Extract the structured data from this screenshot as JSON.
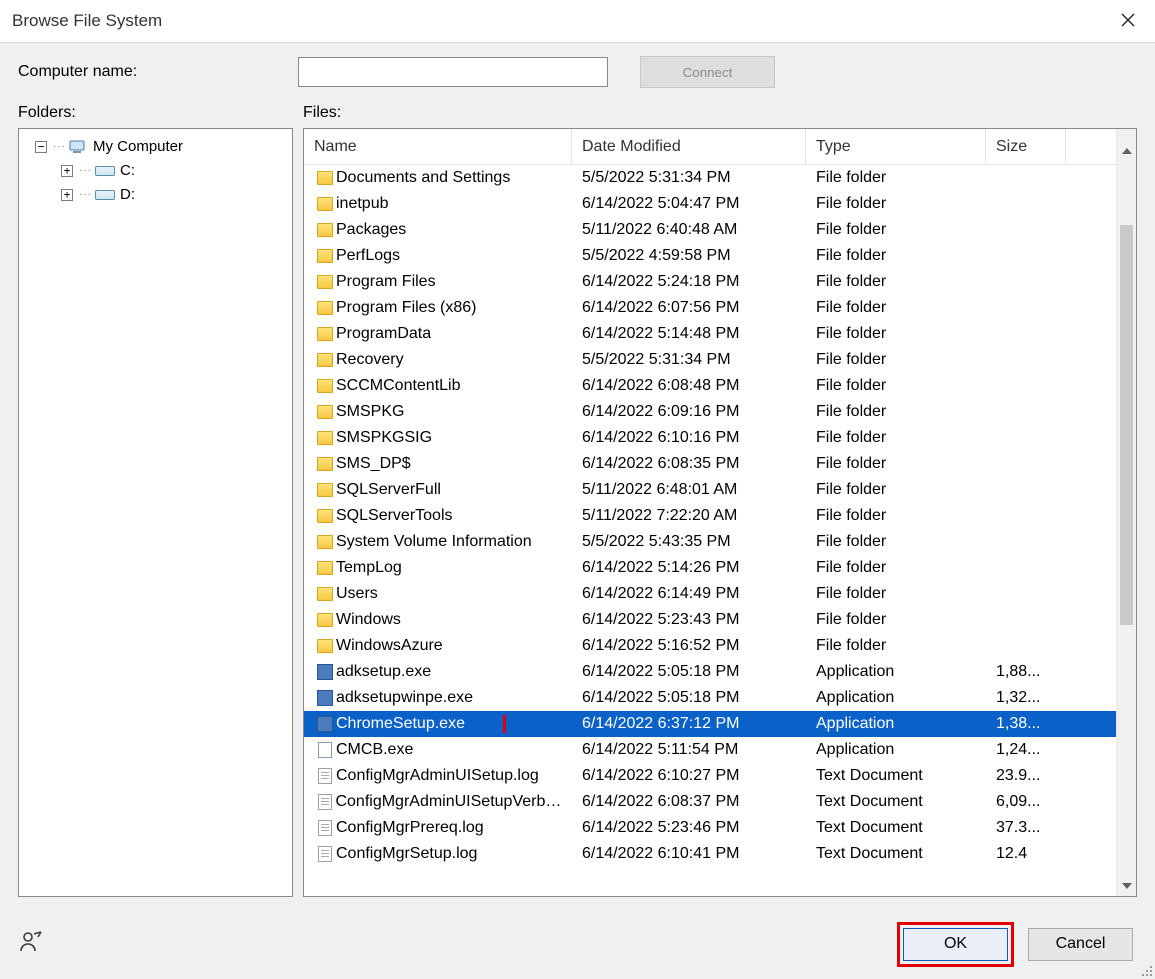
{
  "title": "Browse File System",
  "labels": {
    "computer_name": "Computer name:",
    "connect": "Connect",
    "folders": "Folders:",
    "files": "Files:"
  },
  "tree": {
    "root": "My Computer",
    "drives": [
      "C:",
      "D:"
    ]
  },
  "columns": {
    "name": "Name",
    "date": "Date Modified",
    "type": "Type",
    "size": "Size"
  },
  "files": [
    {
      "icon": "folder",
      "name": "Documents and Settings",
      "date": "5/5/2022 5:31:34 PM",
      "type": "File folder",
      "size": ""
    },
    {
      "icon": "folder",
      "name": "inetpub",
      "date": "6/14/2022 5:04:47 PM",
      "type": "File folder",
      "size": ""
    },
    {
      "icon": "folder",
      "name": "Packages",
      "date": "5/11/2022 6:40:48 AM",
      "type": "File folder",
      "size": ""
    },
    {
      "icon": "folder",
      "name": "PerfLogs",
      "date": "5/5/2022 4:59:58 PM",
      "type": "File folder",
      "size": ""
    },
    {
      "icon": "folder",
      "name": "Program Files",
      "date": "6/14/2022 5:24:18 PM",
      "type": "File folder",
      "size": ""
    },
    {
      "icon": "folder",
      "name": "Program Files (x86)",
      "date": "6/14/2022 6:07:56 PM",
      "type": "File folder",
      "size": ""
    },
    {
      "icon": "folder",
      "name": "ProgramData",
      "date": "6/14/2022 5:14:48 PM",
      "type": "File folder",
      "size": ""
    },
    {
      "icon": "folder",
      "name": "Recovery",
      "date": "5/5/2022 5:31:34 PM",
      "type": "File folder",
      "size": ""
    },
    {
      "icon": "folder",
      "name": "SCCMContentLib",
      "date": "6/14/2022 6:08:48 PM",
      "type": "File folder",
      "size": ""
    },
    {
      "icon": "folder",
      "name": "SMSPKG",
      "date": "6/14/2022 6:09:16 PM",
      "type": "File folder",
      "size": ""
    },
    {
      "icon": "folder",
      "name": "SMSPKGSIG",
      "date": "6/14/2022 6:10:16 PM",
      "type": "File folder",
      "size": ""
    },
    {
      "icon": "folder",
      "name": "SMS_DP$",
      "date": "6/14/2022 6:08:35 PM",
      "type": "File folder",
      "size": ""
    },
    {
      "icon": "folder",
      "name": "SQLServerFull",
      "date": "5/11/2022 6:48:01 AM",
      "type": "File folder",
      "size": ""
    },
    {
      "icon": "folder",
      "name": "SQLServerTools",
      "date": "5/11/2022 7:22:20 AM",
      "type": "File folder",
      "size": ""
    },
    {
      "icon": "folder",
      "name": "System Volume Information",
      "date": "5/5/2022 5:43:35 PM",
      "type": "File folder",
      "size": ""
    },
    {
      "icon": "folder",
      "name": "TempLog",
      "date": "6/14/2022 5:14:26 PM",
      "type": "File folder",
      "size": ""
    },
    {
      "icon": "folder",
      "name": "Users",
      "date": "6/14/2022 6:14:49 PM",
      "type": "File folder",
      "size": ""
    },
    {
      "icon": "folder",
      "name": "Windows",
      "date": "6/14/2022 5:23:43 PM",
      "type": "File folder",
      "size": ""
    },
    {
      "icon": "folder",
      "name": "WindowsAzure",
      "date": "6/14/2022 5:16:52 PM",
      "type": "File folder",
      "size": ""
    },
    {
      "icon": "exe",
      "name": "adksetup.exe",
      "date": "6/14/2022 5:05:18 PM",
      "type": "Application",
      "size": "1,88..."
    },
    {
      "icon": "exe",
      "name": "adksetupwinpe.exe",
      "date": "6/14/2022 5:05:18 PM",
      "type": "Application",
      "size": "1,32..."
    },
    {
      "icon": "exe",
      "name": "ChromeSetup.exe",
      "date": "6/14/2022 6:37:12 PM",
      "type": "Application",
      "size": "1,38...",
      "selected": true,
      "highlighted": true
    },
    {
      "icon": "cfg",
      "name": "CMCB.exe",
      "date": "6/14/2022 5:11:54 PM",
      "type": "Application",
      "size": "1,24..."
    },
    {
      "icon": "txt",
      "name": "ConfigMgrAdminUISetup.log",
      "date": "6/14/2022 6:10:27 PM",
      "type": "Text Document",
      "size": "23.9..."
    },
    {
      "icon": "txt",
      "name": "ConfigMgrAdminUISetupVerbo...",
      "date": "6/14/2022 6:08:37 PM",
      "type": "Text Document",
      "size": "6,09..."
    },
    {
      "icon": "txt",
      "name": "ConfigMgrPrereq.log",
      "date": "6/14/2022 5:23:46 PM",
      "type": "Text Document",
      "size": "37.3..."
    },
    {
      "icon": "txt",
      "name": "ConfigMgrSetup.log",
      "date": "6/14/2022 6:10:41 PM",
      "type": "Text Document",
      "size": "12.4"
    }
  ],
  "buttons": {
    "ok": "OK",
    "cancel": "Cancel"
  }
}
